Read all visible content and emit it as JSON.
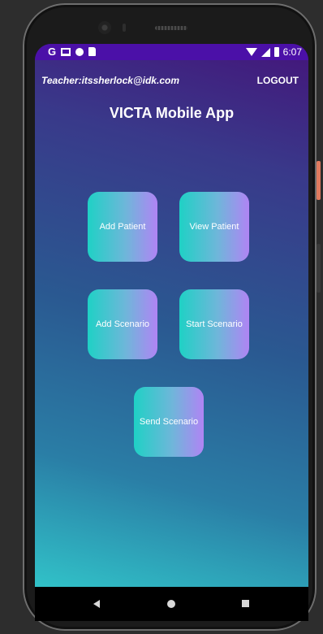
{
  "status_bar": {
    "time": "6:07",
    "left_icons": [
      "g-icon",
      "gmail-icon",
      "circle-icon",
      "sd-card-icon"
    ],
    "right_icons": [
      "wifi-icon",
      "signal-icon",
      "battery-icon"
    ],
    "g_glyph": "G",
    "background_color": "#4b10a8"
  },
  "header": {
    "user_label": "Teacher:itssherlock@idk.com",
    "logout_label": "LOGOUT"
  },
  "app": {
    "title": "VICTA Mobile App"
  },
  "actions": [
    {
      "label": "Add Patient"
    },
    {
      "label": "View Patient"
    },
    {
      "label": "Add Scenario"
    },
    {
      "label": "Start Scenario"
    },
    {
      "label": "Send Scenario"
    }
  ],
  "nav_bar": {
    "buttons": [
      "back-icon",
      "home-icon",
      "recents-icon"
    ]
  },
  "colors": {
    "tile_gradient_start": "#1fd1c5",
    "tile_gradient_end": "#b084f4",
    "background_top": "#44157a",
    "background_bottom": "#31c2c8"
  }
}
